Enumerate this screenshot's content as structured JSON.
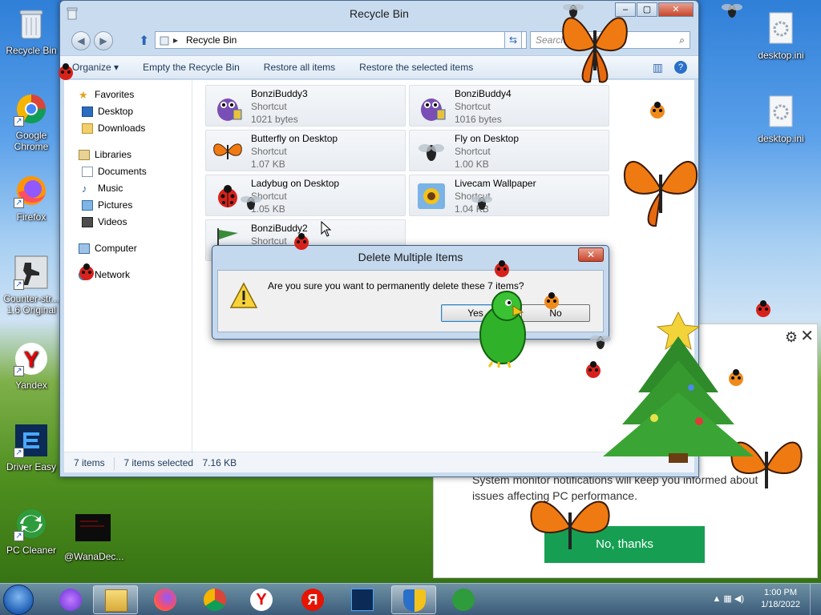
{
  "desktop": {
    "icons": [
      {
        "label": "Recycle Bin"
      },
      {
        "label": "Google Chrome"
      },
      {
        "label": "Firefox"
      },
      {
        "label": "Counter-str... 1.6 Original"
      },
      {
        "label": "Yandex"
      },
      {
        "label": "Driver Easy"
      },
      {
        "label": "PC Cleaner"
      },
      {
        "label": "@WanaDec..."
      },
      {
        "label": "desktop.ini"
      },
      {
        "label": "desktop.ini"
      }
    ]
  },
  "explorer": {
    "title": "Recycle Bin",
    "address": "Recycle Bin",
    "search_placeholder": "Search Recycle Bin",
    "toolbar": {
      "organize": "Organize ▾",
      "empty": "Empty the Recycle Bin",
      "restore_all": "Restore all items",
      "restore_selected": "Restore the selected items"
    },
    "nav": {
      "favorites": "Favorites",
      "desktop": "Desktop",
      "downloads": "Downloads",
      "libraries": "Libraries",
      "documents": "Documents",
      "music": "Music",
      "pictures": "Pictures",
      "videos": "Videos",
      "computer": "Computer",
      "network": "Network"
    },
    "files": [
      {
        "name": "BonziBuddy3",
        "type": "Shortcut",
        "size": "1021 bytes"
      },
      {
        "name": "BonziBuddy4",
        "type": "Shortcut",
        "size": "1016 bytes"
      },
      {
        "name": "Butterfly on Desktop",
        "type": "Shortcut",
        "size": "1.07 KB"
      },
      {
        "name": "Fly on Desktop",
        "type": "Shortcut",
        "size": "1.00 KB"
      },
      {
        "name": "Ladybug on Desktop",
        "type": "Shortcut",
        "size": "1.05 KB"
      },
      {
        "name": "Livecam Wallpaper",
        "type": "Shortcut",
        "size": "1.04 KB"
      },
      {
        "name": "BonziBuddy2",
        "type": "Shortcut",
        "size": ""
      }
    ],
    "status": {
      "count": "7 items",
      "selected": "7 items selected",
      "size": "7.16 KB"
    }
  },
  "dialog": {
    "title": "Delete Multiple Items",
    "message": "Are you sure you want to permanently delete these 7 items?",
    "yes": "Yes",
    "no": "No",
    "close": "✕"
  },
  "notification": {
    "text": "System monitor notifications will keep you informed about issues affecting PC performance.",
    "button": "No, thanks"
  },
  "taskbar": {
    "time": "1:00 PM",
    "date": "1/18/2022"
  },
  "colors": {
    "accent": "#169f52",
    "window_frame": "#c9dcef"
  }
}
